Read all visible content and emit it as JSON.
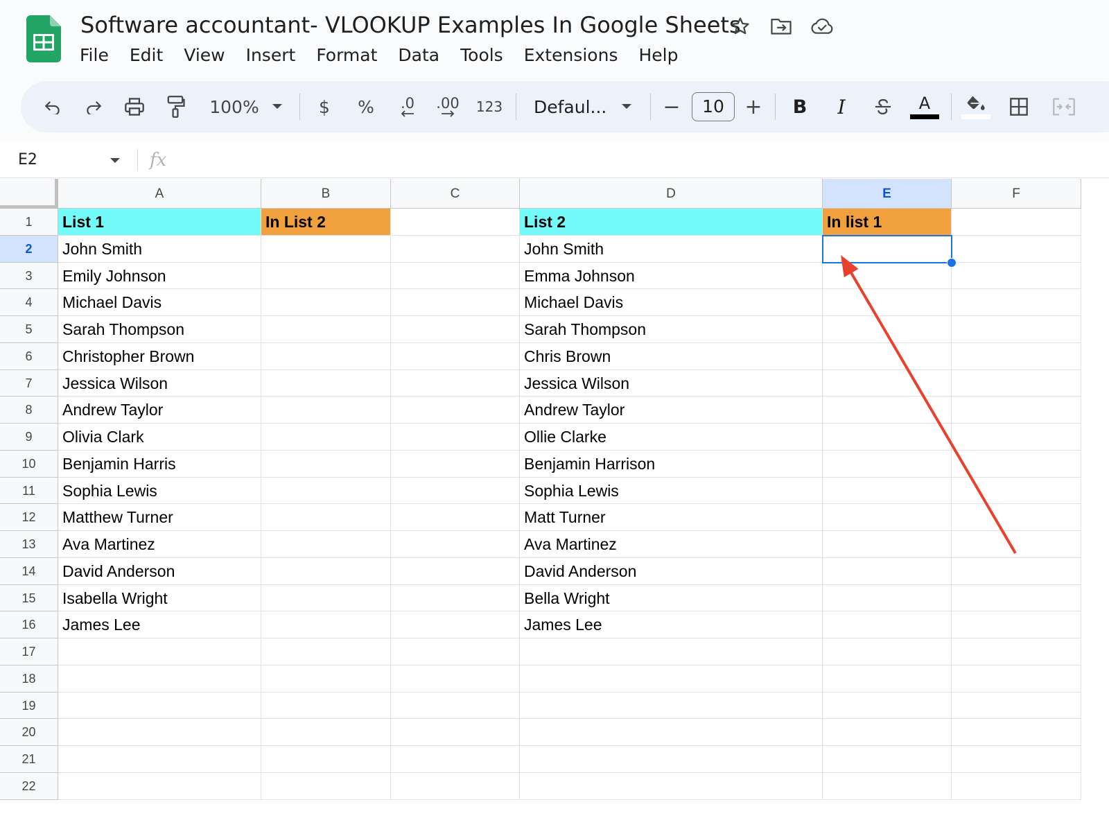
{
  "document": {
    "title": "Software accountant- VLOOKUP Examples In Google Sheets"
  },
  "menu": [
    "File",
    "Edit",
    "View",
    "Insert",
    "Format",
    "Data",
    "Tools",
    "Extensions",
    "Help"
  ],
  "toolbar": {
    "zoom": "100%",
    "currency_label": "$",
    "percent_label": "%",
    "decrease_decimal_label": ".0",
    "increase_decimal_label": ".00",
    "more_formats_label": "123",
    "font_family": "Defaul...",
    "font_size": "10",
    "minus_label": "−",
    "plus_label": "+",
    "bold_label": "B",
    "italic_label": "I",
    "text_color_label": "A"
  },
  "formula_bar": {
    "name_box": "E2",
    "fx_label": "fx",
    "formula": ""
  },
  "sheet": {
    "columns": [
      "A",
      "B",
      "C",
      "D",
      "E",
      "F"
    ],
    "active_column": "E",
    "row_numbers": [
      "1",
      "2",
      "3",
      "4",
      "5",
      "6",
      "7",
      "8",
      "9",
      "10",
      "11",
      "12",
      "13",
      "14",
      "15",
      "16",
      "17",
      "18",
      "19",
      "20",
      "21",
      "22"
    ],
    "active_row": "2",
    "selected_cell": "E2",
    "header_row": {
      "A": "List 1",
      "B": "In List 2",
      "D": "List 2",
      "E": "In list 1"
    },
    "list1": [
      "John Smith",
      "Emily Johnson",
      "Michael Davis",
      "Sarah Thompson",
      "Christopher Brown",
      "Jessica Wilson",
      "Andrew Taylor",
      "Olivia Clark",
      "Benjamin Harris",
      "Sophia Lewis",
      "Matthew Turner",
      "Ava Martinez",
      "David Anderson",
      "Isabella Wright",
      "James Lee"
    ],
    "list2": [
      "John Smith",
      "Emma Johnson",
      "Michael Davis",
      "Sarah Thompson",
      "Chris Brown",
      "Jessica Wilson",
      "Andrew Taylor",
      "Ollie Clarke",
      "Benjamin Harrison",
      "Sophia Lewis",
      "Matt Turner",
      "Ava Martinez",
      "David Anderson",
      "Bella Wright",
      "James Lee"
    ]
  },
  "colors": {
    "list_header": "#72fbf8",
    "flag_header": "#f0a03c",
    "selection": "#1a73e8",
    "annotation_arrow": "#e8412c"
  }
}
